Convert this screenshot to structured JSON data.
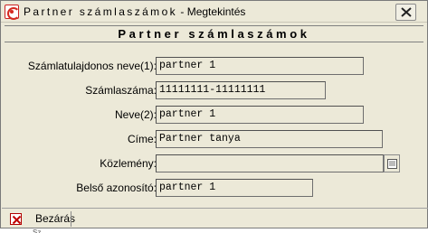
{
  "window": {
    "title_spaced": "Partner számlaszámok",
    "title_suffix": " - Megtekintés"
  },
  "header": {
    "title": "Partner számlaszámok"
  },
  "form": {
    "fields": [
      {
        "label": "Számlatulajdonos neve(1):",
        "value": "partner 1"
      },
      {
        "label": "Számlaszáma:",
        "value": "11111111-11111111"
      },
      {
        "label": "Neve(2):",
        "value": "partner 1"
      },
      {
        "label": "Címe:",
        "value": "Partner tanya"
      },
      {
        "label": "Közlemény:",
        "value": ""
      },
      {
        "label": "Belső azonosító:",
        "value": "partner 1"
      }
    ]
  },
  "footer": {
    "close_label": "Bezárás"
  },
  "behind": {
    "text": "Sz"
  },
  "colors": {
    "window_bg": "#ece9d8",
    "close_icon_red": "#c00000"
  },
  "icons": {
    "app": "app-logo-icon",
    "window_close": "window-close-icon",
    "lookup": "notepad-icon",
    "footer_close": "red-x-icon"
  }
}
